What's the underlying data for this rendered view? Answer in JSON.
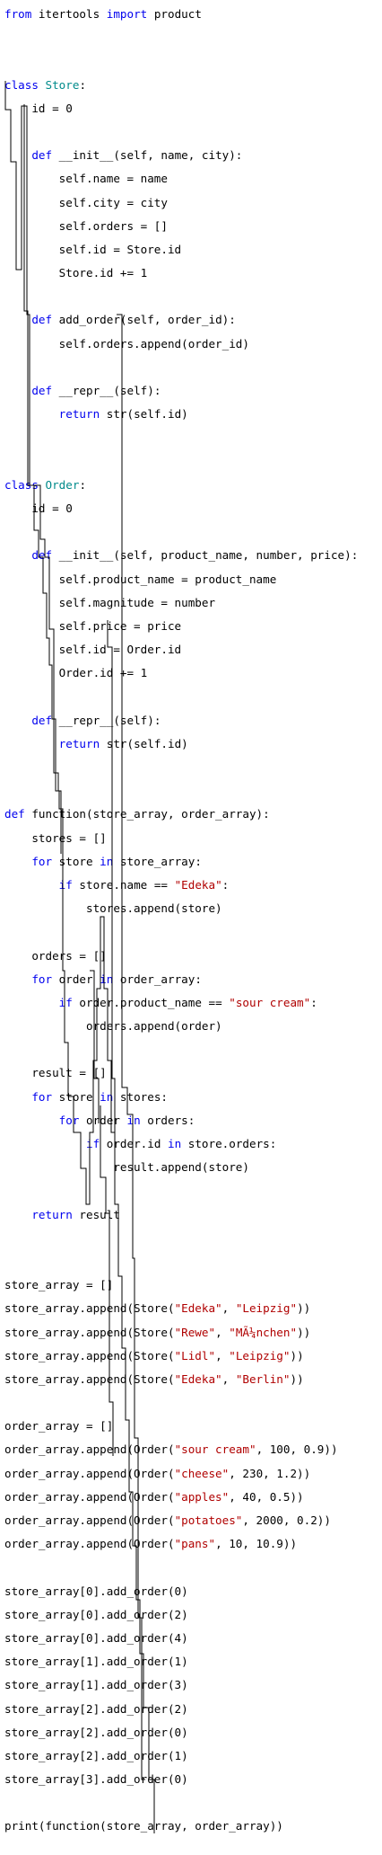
{
  "editor": {
    "colors": {
      "background": "#ffffff",
      "text": "#000000",
      "keyword": "#0000ee",
      "class_name": "#008b8b",
      "string": "#b00000"
    },
    "lines": [
      [
        {
          "t": "from",
          "c": "kw"
        },
        {
          "t": " itertools "
        },
        {
          "t": "import",
          "c": "kw"
        },
        {
          "t": " product"
        }
      ],
      [],
      [],
      [
        {
          "t": "class",
          "c": "kw"
        },
        {
          "t": " "
        },
        {
          "t": "Store",
          "c": "cls"
        },
        {
          "t": ":"
        }
      ],
      [
        {
          "t": "    id = 0"
        }
      ],
      [],
      [
        {
          "t": "    "
        },
        {
          "t": "def",
          "c": "kw"
        },
        {
          "t": " __init__(self, name, city):"
        }
      ],
      [
        {
          "t": "        self.name = name"
        }
      ],
      [
        {
          "t": "        self.city = city"
        }
      ],
      [
        {
          "t": "        self.orders = []"
        }
      ],
      [
        {
          "t": "        self.id = Store.id"
        }
      ],
      [
        {
          "t": "        Store.id += 1"
        }
      ],
      [],
      [
        {
          "t": "    "
        },
        {
          "t": "def",
          "c": "kw"
        },
        {
          "t": " add_order(self, order_id):"
        }
      ],
      [
        {
          "t": "        self.orders.append(order_id)"
        }
      ],
      [],
      [
        {
          "t": "    "
        },
        {
          "t": "def",
          "c": "kw"
        },
        {
          "t": " __repr__(self):"
        }
      ],
      [
        {
          "t": "        "
        },
        {
          "t": "return",
          "c": "kw"
        },
        {
          "t": " str(self.id)"
        }
      ],
      [],
      [],
      [
        {
          "t": "class",
          "c": "kw"
        },
        {
          "t": " "
        },
        {
          "t": "Order",
          "c": "cls"
        },
        {
          "t": ":"
        }
      ],
      [
        {
          "t": "    id = 0"
        }
      ],
      [],
      [
        {
          "t": "    "
        },
        {
          "t": "def",
          "c": "kw"
        },
        {
          "t": " __init__(self, product_name, number, price):"
        }
      ],
      [
        {
          "t": "        self.product_name = product_name"
        }
      ],
      [
        {
          "t": "        self.magnitude = number"
        }
      ],
      [
        {
          "t": "        self.price = price"
        }
      ],
      [
        {
          "t": "        self.id = Order.id"
        }
      ],
      [
        {
          "t": "        Order.id += 1"
        }
      ],
      [],
      [
        {
          "t": "    "
        },
        {
          "t": "def",
          "c": "kw"
        },
        {
          "t": " __repr__(self):"
        }
      ],
      [
        {
          "t": "        "
        },
        {
          "t": "return",
          "c": "kw"
        },
        {
          "t": " str(self.id)"
        }
      ],
      [],
      [],
      [
        {
          "t": "def",
          "c": "kw"
        },
        {
          "t": " function(store_array, order_array):"
        }
      ],
      [
        {
          "t": "    stores = []"
        }
      ],
      [
        {
          "t": "    "
        },
        {
          "t": "for",
          "c": "kw"
        },
        {
          "t": " store "
        },
        {
          "t": "in",
          "c": "kw"
        },
        {
          "t": " store_array:"
        }
      ],
      [
        {
          "t": "        "
        },
        {
          "t": "if",
          "c": "kw"
        },
        {
          "t": " store.name == "
        },
        {
          "t": "\"Edeka\"",
          "c": "str"
        },
        {
          "t": ":"
        }
      ],
      [
        {
          "t": "            stores.append(store)"
        }
      ],
      [],
      [
        {
          "t": "    orders = []"
        }
      ],
      [
        {
          "t": "    "
        },
        {
          "t": "for",
          "c": "kw"
        },
        {
          "t": " order "
        },
        {
          "t": "in",
          "c": "kw"
        },
        {
          "t": " order_array:"
        }
      ],
      [
        {
          "t": "        "
        },
        {
          "t": "if",
          "c": "kw"
        },
        {
          "t": " order.product_name == "
        },
        {
          "t": "\"sour cream\"",
          "c": "str"
        },
        {
          "t": ":"
        }
      ],
      [
        {
          "t": "            orders.append(order)"
        }
      ],
      [],
      [
        {
          "t": "    result = []"
        }
      ],
      [
        {
          "t": "    "
        },
        {
          "t": "for",
          "c": "kw"
        },
        {
          "t": " store "
        },
        {
          "t": "in",
          "c": "kw"
        },
        {
          "t": " stores:"
        }
      ],
      [
        {
          "t": "        "
        },
        {
          "t": "for",
          "c": "kw"
        },
        {
          "t": " order "
        },
        {
          "t": "in",
          "c": "kw"
        },
        {
          "t": " orders:"
        }
      ],
      [
        {
          "t": "            "
        },
        {
          "t": "if",
          "c": "kw"
        },
        {
          "t": " order.id "
        },
        {
          "t": "in",
          "c": "kw"
        },
        {
          "t": " store.orders:"
        }
      ],
      [
        {
          "t": "                result.append(store)"
        }
      ],
      [],
      [
        {
          "t": "    "
        },
        {
          "t": "return",
          "c": "kw"
        },
        {
          "t": " result"
        }
      ],
      [],
      [],
      [
        {
          "t": "store_array = []"
        }
      ],
      [
        {
          "t": "store_array.append(Store("
        },
        {
          "t": "\"Edeka\"",
          "c": "str"
        },
        {
          "t": ", "
        },
        {
          "t": "\"Leipzig\"",
          "c": "str"
        },
        {
          "t": "))"
        }
      ],
      [
        {
          "t": "store_array.append(Store("
        },
        {
          "t": "\"Rewe\"",
          "c": "str"
        },
        {
          "t": ", "
        },
        {
          "t": "\"MÃ¼nchen\"",
          "c": "str"
        },
        {
          "t": "))"
        }
      ],
      [
        {
          "t": "store_array.append(Store("
        },
        {
          "t": "\"Lidl\"",
          "c": "str"
        },
        {
          "t": ", "
        },
        {
          "t": "\"Leipzig\"",
          "c": "str"
        },
        {
          "t": "))"
        }
      ],
      [
        {
          "t": "store_array.append(Store("
        },
        {
          "t": "\"Edeka\"",
          "c": "str"
        },
        {
          "t": ", "
        },
        {
          "t": "\"Berlin\"",
          "c": "str"
        },
        {
          "t": "))"
        }
      ],
      [],
      [
        {
          "t": "order_array = []"
        }
      ],
      [
        {
          "t": "order_array.append(Order("
        },
        {
          "t": "\"sour cream\"",
          "c": "str"
        },
        {
          "t": ", 100, 0.9))"
        }
      ],
      [
        {
          "t": "order_array.append(Order("
        },
        {
          "t": "\"cheese\"",
          "c": "str"
        },
        {
          "t": ", 230, 1.2))"
        }
      ],
      [
        {
          "t": "order_array.append(Order("
        },
        {
          "t": "\"apples\"",
          "c": "str"
        },
        {
          "t": ", 40, 0.5))"
        }
      ],
      [
        {
          "t": "order_array.append(Order("
        },
        {
          "t": "\"potatoes\"",
          "c": "str"
        },
        {
          "t": ", 2000, 0.2))"
        }
      ],
      [
        {
          "t": "order_array.append(Order("
        },
        {
          "t": "\"pans\"",
          "c": "str"
        },
        {
          "t": ", 10, 10.9))"
        }
      ],
      [],
      [
        {
          "t": "store_array[0].add_order(0)"
        }
      ],
      [
        {
          "t": "store_array[0].add_order(2)"
        }
      ],
      [
        {
          "t": "store_array[0].add_order(4)"
        }
      ],
      [
        {
          "t": "store_array[1].add_order(1)"
        }
      ],
      [
        {
          "t": "store_array[1].add_order(3)"
        }
      ],
      [
        {
          "t": "store_array[2].add_order(2)"
        }
      ],
      [
        {
          "t": "store_array[2].add_order(0)"
        }
      ],
      [
        {
          "t": "store_array[2].add_order(1)"
        }
      ],
      [
        {
          "t": "store_array[3].add_order(0)"
        }
      ],
      [],
      [
        {
          "t": "print(function(store_array, order_array))"
        }
      ]
    ]
  }
}
